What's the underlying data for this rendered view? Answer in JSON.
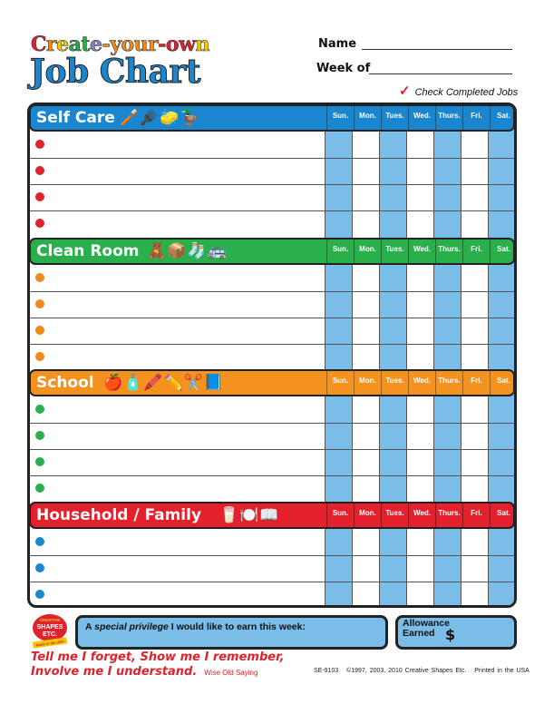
{
  "header": {
    "title_line1_letters": [
      {
        "t": "C",
        "c": "#e0222a"
      },
      {
        "t": "r",
        "c": "#f08a1c"
      },
      {
        "t": "e",
        "c": "#f5c800"
      },
      {
        "t": "a",
        "c": "#2ea84a"
      },
      {
        "t": "t",
        "c": "#2ea84a"
      },
      {
        "t": "e",
        "c": "#8a7fc0"
      },
      {
        "t": "-",
        "c": "#f08a1c"
      },
      {
        "t": "y",
        "c": "#f08a1c"
      },
      {
        "t": "o",
        "c": "#f08a1c"
      },
      {
        "t": "u",
        "c": "#f08a1c"
      },
      {
        "t": "r",
        "c": "#f08a1c"
      },
      {
        "t": "-",
        "c": "#e0222a"
      },
      {
        "t": "o",
        "c": "#e0222a"
      },
      {
        "t": "w",
        "c": "#e0222a"
      },
      {
        "t": "n",
        "c": "#f5c800"
      }
    ],
    "title_line1": "Create-your-own",
    "title_line2": "Job Chart",
    "name_label": "Name",
    "name_value": "",
    "week_label": "Week of",
    "week_value": "",
    "check_note": "Check Completed Jobs",
    "check_icon": "checkmark-icon"
  },
  "days": [
    "Sun.",
    "Mon.",
    "Tues.",
    "Wed.",
    "Thurs.",
    "Fri.",
    "Sat."
  ],
  "sections": [
    {
      "title": "Self Care",
      "color": "#1a86d0",
      "dot_color": "#e0222a",
      "icons": [
        "toothbrush-icon",
        "comb-icon",
        "sponge-icon",
        "rubber-duck-icon"
      ],
      "icon_glyphs": "🪥🪮🧽🦆",
      "rows": [
        "",
        "",
        "",
        ""
      ]
    },
    {
      "title": "Clean Room",
      "color": "#2ab04a",
      "dot_color": "#f08a1c",
      "icons": [
        "teddy-bear-icon",
        "toy-box-icon",
        "socks-icon",
        "toy-bus-icon"
      ],
      "icon_glyphs": "🧸📦🧦🚌",
      "rows": [
        "",
        "",
        "",
        ""
      ]
    },
    {
      "title": "School",
      "color": "#f3921f",
      "dot_color": "#2ab04a",
      "icons": [
        "apple-icon",
        "glue-icon",
        "crayons-icon",
        "pencil-icon",
        "scissors-icon",
        "book-icon"
      ],
      "icon_glyphs": "🍎🧴🖍️✏️✂️📘",
      "rows": [
        "",
        "",
        "",
        ""
      ]
    },
    {
      "title": "Household / Family",
      "color": "#e4202c",
      "dot_color": "#1a86d0",
      "icons": [
        "glass-icon",
        "plate-icon",
        "open-book-icon"
      ],
      "icon_glyphs": "🥛🍽️📖",
      "rows": [
        "",
        "",
        ""
      ]
    }
  ],
  "bottom": {
    "logo_lines": [
      "CREATIVE",
      "SHAPES",
      "ETC."
    ],
    "logo_banner": "Made in the USA",
    "privilege_prefix": "A ",
    "privilege_italic": "special privilege",
    "privilege_suffix": " I would like to earn this week:",
    "privilege_value": "",
    "allowance_line1": "Allowance",
    "allowance_line2": "Earned",
    "allowance_symbol": "$",
    "allowance_value": "",
    "quote_line1": "Tell me I forget, Show me I remember,",
    "quote_line2": "Involve me I understand.",
    "quote_source": "Wise Old Saying",
    "footer": "SE-9103   ©1997, 2003, 2010 Creative Shapes Etc.   Printed in the USA"
  },
  "colors": {
    "shade_column": "#79bde8",
    "border": "#222222",
    "accent_red": "#e0222a"
  }
}
